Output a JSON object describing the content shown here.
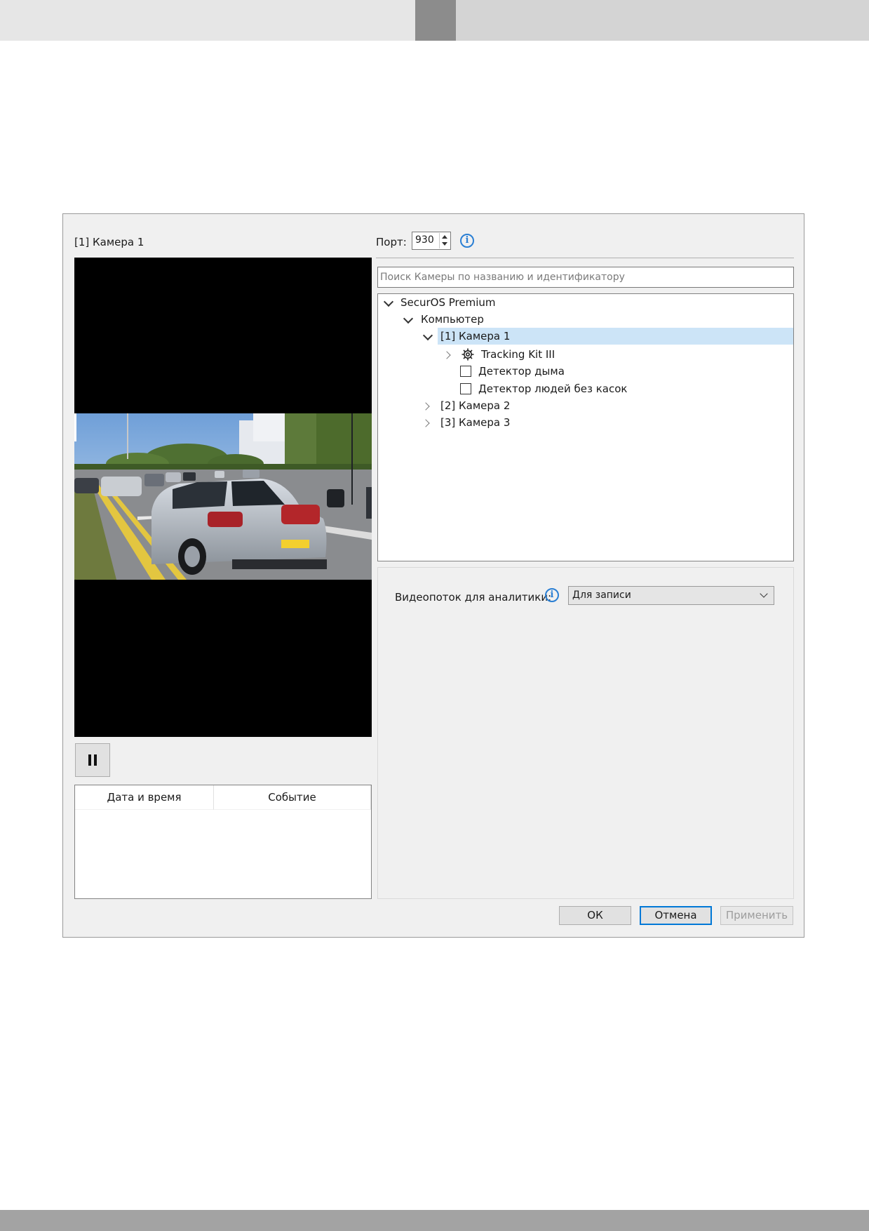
{
  "camera_panel": {
    "title": "[1] Камера 1",
    "pause_icon": "pause-icon"
  },
  "events_table": {
    "columns": [
      "Дата и время",
      "Событие"
    ],
    "rows": []
  },
  "port": {
    "label": "Порт:",
    "value": "930"
  },
  "search": {
    "placeholder": "Поиск Камеры по названию и идентификатору"
  },
  "tree": {
    "root": "SecurOS Premium",
    "computer": "Компьютер",
    "camera1": "[1] Камера 1",
    "tracking_kit": "Tracking Kit III",
    "smoke_detector": "Детектор дыма",
    "no_helmet_detector": "Детектор людей без касок",
    "camera2": "[2] Камера 2",
    "camera3": "[3] Камера 3"
  },
  "analytics": {
    "stream_label": "Видеопоток для аналитики:",
    "stream_value": "Для записи"
  },
  "buttons": {
    "ok": "ОК",
    "cancel": "Отмена",
    "apply": "Применить"
  },
  "colors": {
    "accent": "#0078d7",
    "info_icon": "#2a7fd4",
    "selection": "#cce4f7"
  }
}
